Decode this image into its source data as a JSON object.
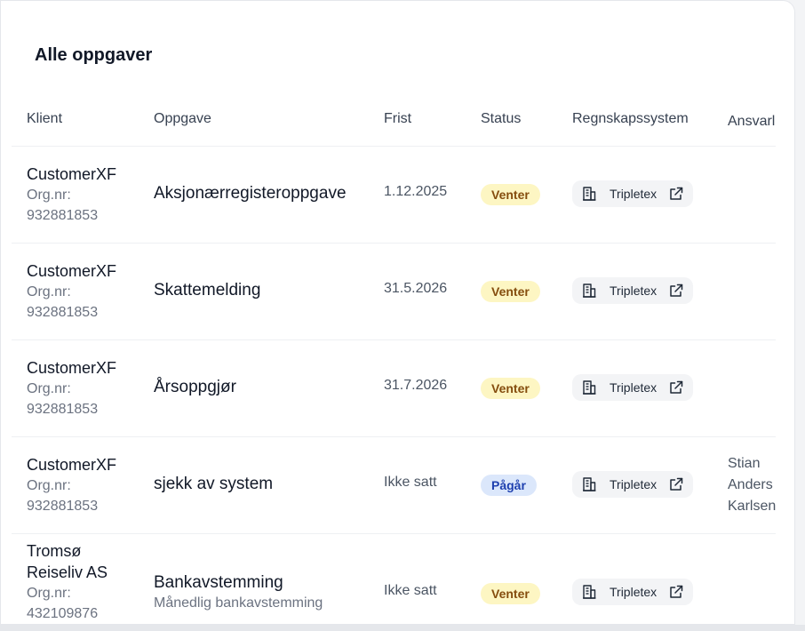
{
  "page": {
    "title": "Alle oppgaver"
  },
  "table": {
    "headers": {
      "client": "Klient",
      "task": "Oppgave",
      "due": "Frist",
      "status": "Status",
      "system": "Regnskapssystem",
      "responsible": "Ansvarlig"
    },
    "rows": [
      {
        "client_lines": [
          "CustomerXF"
        ],
        "org_label": "Org.nr:",
        "org_number": "932881853",
        "task": "Aksjonærregisteroppgave",
        "task_sub": "",
        "due": "1.12.2025",
        "status": "Venter",
        "status_kind": "venter",
        "system": "Tripletex",
        "responsible_lines": []
      },
      {
        "client_lines": [
          "CustomerXF"
        ],
        "org_label": "Org.nr:",
        "org_number": "932881853",
        "task": "Skattemelding",
        "task_sub": "",
        "due": "31.5.2026",
        "status": "Venter",
        "status_kind": "venter",
        "system": "Tripletex",
        "responsible_lines": []
      },
      {
        "client_lines": [
          "CustomerXF"
        ],
        "org_label": "Org.nr:",
        "org_number": "932881853",
        "task": "Årsoppgjør",
        "task_sub": "",
        "due": "31.7.2026",
        "status": "Venter",
        "status_kind": "venter",
        "system": "Tripletex",
        "responsible_lines": []
      },
      {
        "client_lines": [
          "CustomerXF"
        ],
        "org_label": "Org.nr:",
        "org_number": "932881853",
        "task": "sjekk av system",
        "task_sub": "",
        "due": "Ikke satt",
        "status": "Pågår",
        "status_kind": "pagar",
        "system": "Tripletex",
        "responsible_lines": [
          "Stian",
          "Anders",
          "Karlsen"
        ]
      },
      {
        "client_lines": [
          "Tromsø",
          "Reiseliv AS"
        ],
        "org_label": "Org.nr:",
        "org_number": "432109876",
        "task": "Bankavstemming",
        "task_sub": "Månedlig bankavstemming",
        "due": "Ikke satt",
        "status": "Venter",
        "status_kind": "venter",
        "system": "Tripletex",
        "responsible_lines": []
      }
    ]
  },
  "icons": {
    "system_icon": "building-icon",
    "link_icon": "external-link-icon"
  },
  "colors": {
    "venter_bg": "#fdf6c3",
    "venter_text": "#854d0e",
    "pagar_bg": "#dbe7fb",
    "pagar_text": "#1e40af"
  }
}
